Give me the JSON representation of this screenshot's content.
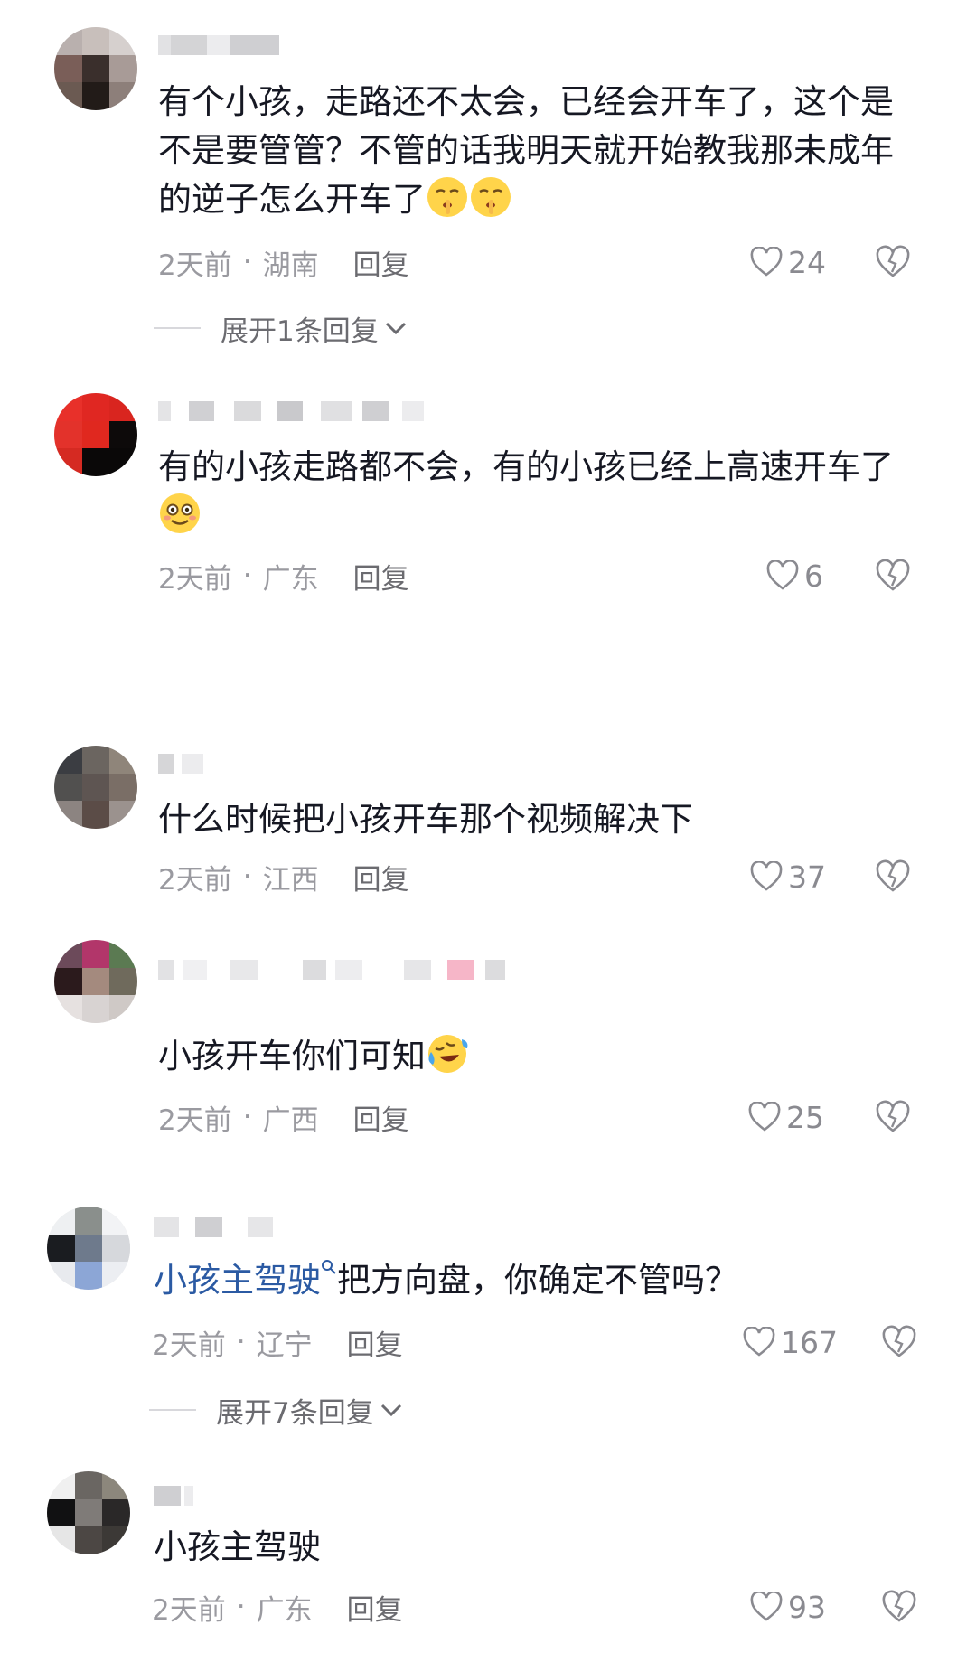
{
  "comments": [
    {
      "lines": [
        "有个小孩，走路还不太会，已经会开车了，这个是",
        "不是要管管？不管的话我明天就开始教我那未成年",
        "的逆子怎么开车了"
      ],
      "emoji_after_last_line": [
        "shushing-face-emoji",
        "shushing-face-emoji"
      ],
      "time": "2天前",
      "location": "湖南",
      "reply": "回复",
      "likes": "24",
      "expand": "展开1条回复"
    },
    {
      "lines": [
        "有的小孩走路都不会，有的小孩已经上高速开车了"
      ],
      "emoji_line": [
        "flushed-smile-emoji"
      ],
      "time": "2天前",
      "location": "广东",
      "reply": "回复",
      "likes": "6"
    },
    {
      "lines": [
        "什么时候把小孩开车那个视频解决下"
      ],
      "time": "2天前",
      "location": "江西",
      "reply": "回复",
      "likes": "37"
    },
    {
      "lines": [
        "小孩开车你们可知"
      ],
      "emoji_after_last_line": [
        "rofl-tears-emoji"
      ],
      "time": "2天前",
      "location": "广西",
      "reply": "回复",
      "likes": "25"
    },
    {
      "mention": "小孩主驾驶",
      "lines": [
        "把方向盘，你确定不管吗？"
      ],
      "time": "2天前",
      "location": "辽宁",
      "reply": "回复",
      "likes": "167",
      "expand": "展开7条回复"
    },
    {
      "lines": [
        "小孩主驾驶"
      ],
      "time": "2天前",
      "location": "广东",
      "reply": "回复",
      "likes": "93"
    }
  ],
  "colors": {
    "text": "#161823",
    "meta": "#9a9aa0",
    "mention": "#2b5aa3",
    "icon": "#8a8a90"
  }
}
